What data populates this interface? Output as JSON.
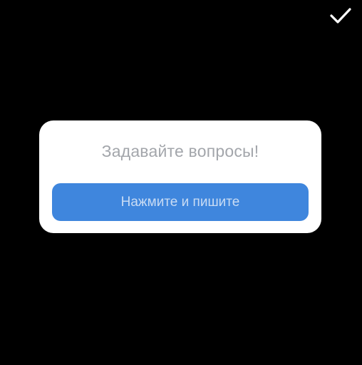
{
  "colors": {
    "background": "#000000",
    "card": "#ffffff",
    "title_text": "#a3a6ab",
    "button_fill": "#3f86dd",
    "button_text": "#c9dcf4",
    "checkmark": "#ffffff"
  },
  "toolbar": {
    "done_icon": "checkmark-icon"
  },
  "question_card": {
    "title": "Задавайте вопросы!",
    "button_label": "Нажмите и пишите"
  }
}
